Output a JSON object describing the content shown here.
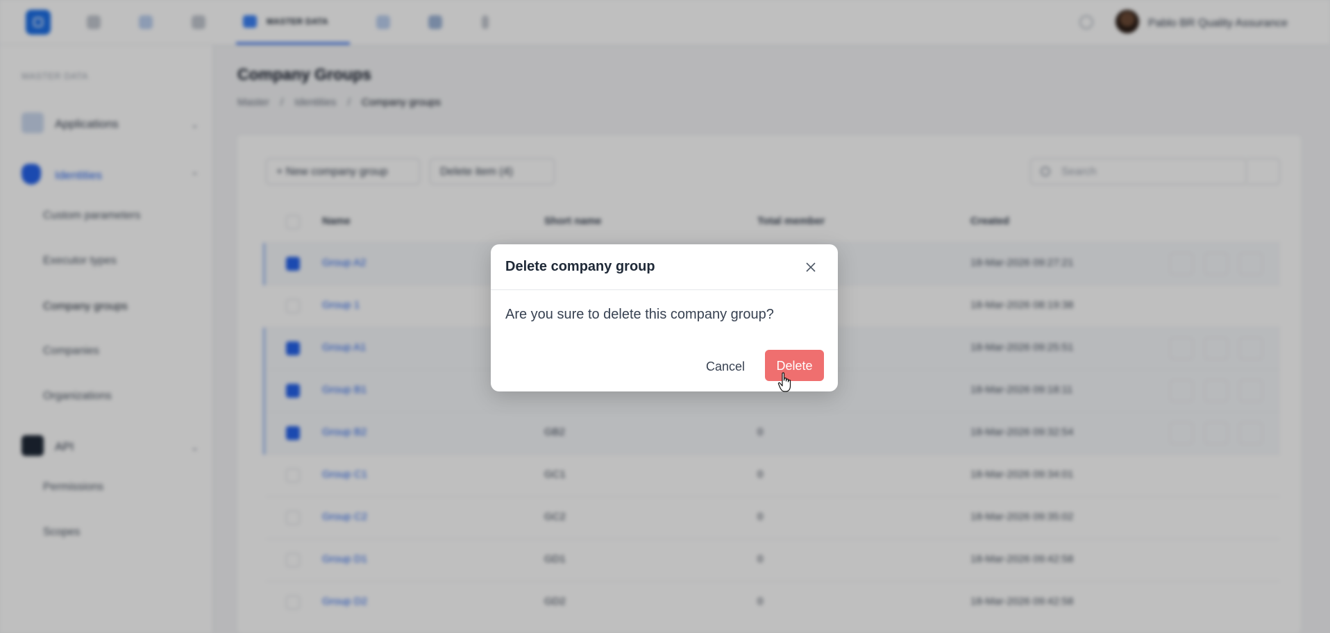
{
  "topbar": {
    "active_tab_label": "MASTER DATA",
    "user_name": "Pablo BR Quality Assurance"
  },
  "sidebar": {
    "section_title": "MASTER DATA",
    "groups": [
      {
        "label": "Applications"
      },
      {
        "label": "Identities"
      },
      {
        "label": "API"
      }
    ],
    "items": [
      {
        "label": "Custom parameters"
      },
      {
        "label": "Executor types"
      },
      {
        "label": "Company groups"
      },
      {
        "label": "Companies"
      },
      {
        "label": "Organizations"
      },
      {
        "label": "Permissions"
      },
      {
        "label": "Scopes"
      }
    ]
  },
  "page": {
    "title": "Company Groups",
    "breadcrumb": [
      "Master",
      "/",
      "Identities",
      "/",
      "Company groups"
    ]
  },
  "toolbar": {
    "new_label": "+ New company group",
    "delete_label": "Delete item (4)",
    "search_placeholder": "Search"
  },
  "table": {
    "headers": {
      "name": "Name",
      "short": "Short name",
      "total": "Total member",
      "created": "Created"
    },
    "rows": [
      {
        "name": "Group A2",
        "short": "",
        "total": "",
        "created": "18-Mar-2026 09:27:21",
        "selected": true
      },
      {
        "name": "Group 1",
        "short": "",
        "total": "",
        "created": "18-Mar-2026 08:19:38",
        "selected": false
      },
      {
        "name": "Group A1",
        "short": "",
        "total": "",
        "created": "18-Mar-2026 09:25:51",
        "selected": true
      },
      {
        "name": "Group B1",
        "short": "",
        "total": "",
        "created": "18-Mar-2026 09:18:11",
        "selected": true
      },
      {
        "name": "Group B2",
        "short": "GB2",
        "total": "0",
        "created": "18-Mar-2026 09:32:54",
        "selected": true
      },
      {
        "name": "Group C1",
        "short": "GC1",
        "total": "0",
        "created": "18-Mar-2026 09:34:01",
        "selected": false
      },
      {
        "name": "Group C2",
        "short": "GC2",
        "total": "0",
        "created": "18-Mar-2026 09:35:02",
        "selected": false
      },
      {
        "name": "Group D1",
        "short": "GD1",
        "total": "0",
        "created": "18-Mar-2026 09:42:58",
        "selected": false
      },
      {
        "name": "Group D2",
        "short": "GD2",
        "total": "0",
        "created": "18-Mar-2026 09:42:58",
        "selected": false
      }
    ]
  },
  "modal": {
    "title": "Delete company group",
    "message": "Are you sure to delete this company group?",
    "cancel_label": "Cancel",
    "delete_label": "Delete"
  },
  "colors": {
    "primary": "#2563eb",
    "danger": "#ef6f6f"
  }
}
